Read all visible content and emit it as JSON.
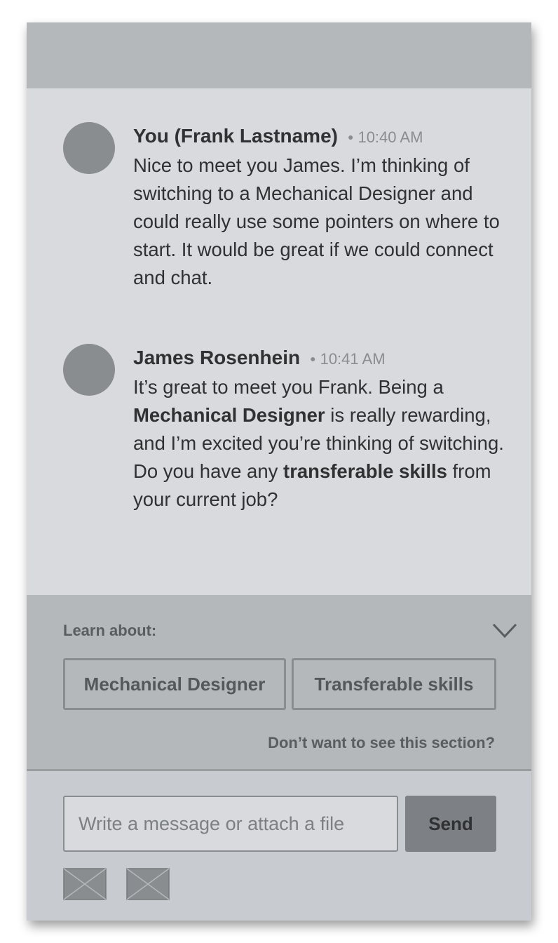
{
  "conversation": {
    "messages": [
      {
        "sender": "You (Frank Lastname)",
        "time": "10:40 AM",
        "text": "Nice to meet you James. I’m thinking of switching to a Mechanical Designer and could really use some pointers on where to start. It would be great if we could connect and chat."
      },
      {
        "sender": "James Rosenhein",
        "time": "10:41 AM",
        "text_parts": [
          "It’s great to meet you Frank. Being a ",
          "Mechanical Designer",
          " is really rewarding, and I’m excited you’re thinking of switching. Do you have any ",
          "transferable skills",
          " from your current job?"
        ]
      }
    ]
  },
  "learn": {
    "label": "Learn about:",
    "chips": [
      "Mechanical Designer",
      "Transferable skills"
    ],
    "hide_link": "Don’t want to see this section?",
    "collapse_icon": "chevron-down-icon"
  },
  "compose": {
    "placeholder": "Write a message or attach a file",
    "send_label": "Send",
    "attachments": [
      "image-placeholder-icon",
      "image-placeholder-icon"
    ]
  },
  "colors": {
    "chat_background": "#d8dadd",
    "panel_background": "#b5b8bb",
    "compose_background": "#c8cbcf",
    "send_button": "#7d8084",
    "avatar": "#8a8d90"
  }
}
